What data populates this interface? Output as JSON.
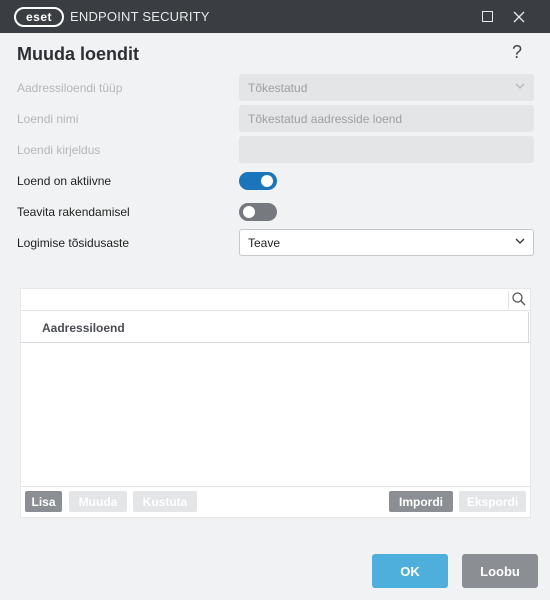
{
  "titlebar": {
    "logo_text": "eset",
    "product": "ENDPOINT SECURITY",
    "minimize_icon": "square-icon",
    "close_icon": "x-icon"
  },
  "dialog": {
    "title": "Muuda loendit",
    "help": "?"
  },
  "form": {
    "list_type": {
      "label": "Aadressiloendi tüüp",
      "value": "Tõkestatud"
    },
    "list_name": {
      "label": "Loendi nimi",
      "value": "Tõkestatud aadresside loend"
    },
    "list_description": {
      "label": "Loendi kirjeldus",
      "value": ""
    },
    "list_active": {
      "label": "Loend on aktiivne",
      "state": "on"
    },
    "notify": {
      "label": "Teavita rakendamisel",
      "state": "off"
    },
    "log_severity": {
      "label": "Logimise tõsidusaste",
      "value": "Teave"
    }
  },
  "table": {
    "column_header": "Aadressiloend",
    "rows": []
  },
  "toolbar": {
    "add": "Lisa",
    "edit": "Muuda",
    "delete": "Kustuta",
    "import": "Impordi",
    "export": "Ekspordi"
  },
  "buttons": {
    "ok": "OK",
    "cancel": "Loobu"
  },
  "colors": {
    "titlebar": "#3a3d42",
    "toggle_on": "#1b75bb",
    "ok_button": "#4eaedc",
    "neutral_button": "#8b8f94"
  }
}
